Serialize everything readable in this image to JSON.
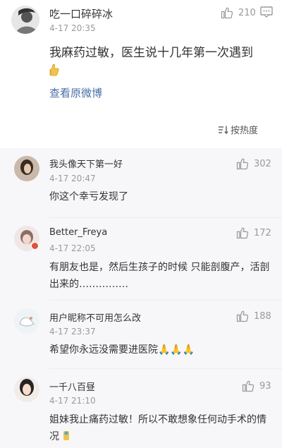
{
  "post": {
    "user": "吃一口碎碎冰",
    "time": "4-17 20:35",
    "likes": "210",
    "text": "我麻药过敏，医生说十几年第一次遇到",
    "link": "查看原微博",
    "sort": "按热度"
  },
  "comments": [
    {
      "user": "我头像天下第一好",
      "time": "4-17 20:47",
      "likes": "302",
      "text": "你这个幸亏发现了"
    },
    {
      "user": "Better_Freya",
      "time": "4-17 22:05",
      "likes": "172",
      "text": "有朋友也是，然后生孩子的时候 只能剖腹产，活剖出来的……………"
    },
    {
      "user": "用户昵称不可用怎么改",
      "time": "4-17 23:37",
      "likes": "188",
      "text": "希望你永远没需要进医院🙏🙏🙏"
    },
    {
      "user": "一千八百昼",
      "time": "4-17 21:10",
      "likes": "93",
      "text": "姐妹我止痛药过敏！所以不敢想象任何动手术的情况"
    }
  ],
  "icons": {
    "like": "thumb-up-icon",
    "menu": "chat-menu-icon",
    "sort": "sort-icon"
  }
}
